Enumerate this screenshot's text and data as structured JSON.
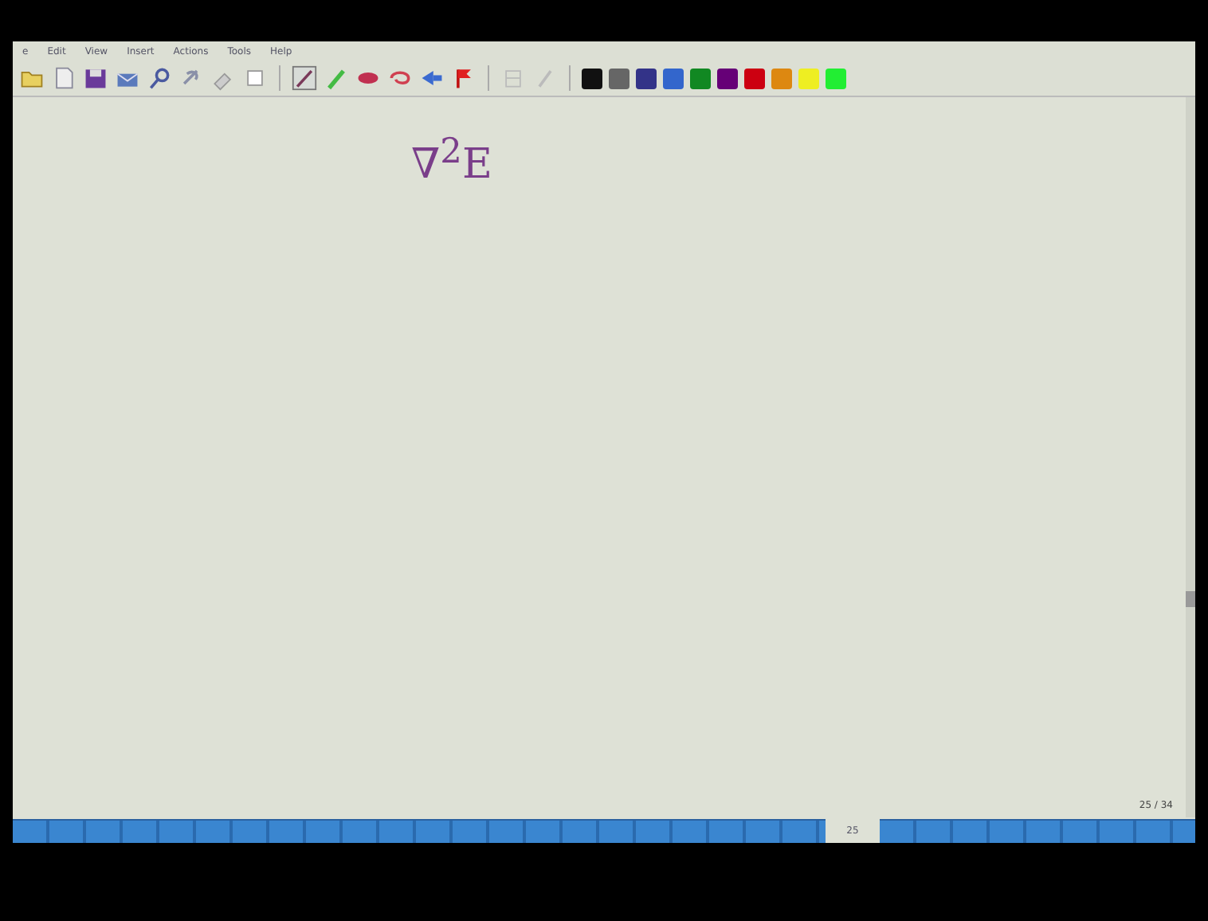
{
  "menu": [
    "e",
    "Edit",
    "View",
    "Insert",
    "Actions",
    "Tools",
    "Help"
  ],
  "palette": [
    {
      "color": "#111111"
    },
    {
      "color": "#666666"
    },
    {
      "color": "#333388"
    },
    {
      "color": "#3366cc"
    },
    {
      "color": "#118822"
    },
    {
      "color": "#660077"
    },
    {
      "color": "#cc0011"
    },
    {
      "color": "#dd8811"
    },
    {
      "color": "#eeee22"
    },
    {
      "color": "#22ee33"
    }
  ],
  "ink": "∇$^{2}$E",
  "page_counter": "25 / 34",
  "page_tab": "25"
}
